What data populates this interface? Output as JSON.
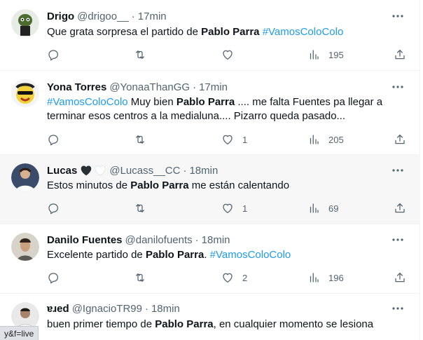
{
  "tweets": [
    {
      "name": "Drigo",
      "handle": "@drigoo__",
      "time": "17min",
      "pre": "Que grata sorpresa el partido de ",
      "bold": "Pablo Parra",
      "post": " ",
      "tag": "#VamosColoColo",
      "post2": "",
      "line2": "",
      "likes": "",
      "views": "195"
    },
    {
      "name": "Yona Torres",
      "handle": "@YonaaThanGG",
      "time": "17min",
      "tag": "#VamosColoColo",
      "pre": " Muy bien ",
      "bold": "Pablo Parra",
      "post": " .... me falta Fuentes pa llegar a",
      "line2": "terminar esos centros a la medialuna.... Pizarro queda pasado...",
      "likes": "1",
      "views": "205"
    },
    {
      "name": "Lucas",
      "handle": "@Lucass__CC",
      "time": "18min",
      "pre": "Estos minutos de ",
      "bold": "Pablo Parra",
      "post": " me están calentando",
      "likes": "1",
      "views": "69",
      "hearts": [
        "black-heart-icon",
        "white-heart-icon"
      ]
    },
    {
      "name": "Danilo Fuentes",
      "handle": "@danilofuents",
      "time": "18min",
      "pre": "Excelente partido de ",
      "bold": "Pablo Parra",
      "post": ". ",
      "tag": "#VamosColoColo",
      "likes": "2",
      "views": "196"
    },
    {
      "name": "ɐɹed",
      "handle": "@IgnacioTR99",
      "time": "18min",
      "pre": "buen primer tiempo de ",
      "bold": "Pablo Parra",
      "post": ", en cualquier momento se lesiona"
    }
  ],
  "separator": "·",
  "status_url": "y&f=live",
  "icons": {
    "reply": "reply-icon",
    "retweet": "retweet-icon",
    "like": "heart-icon",
    "views": "views-icon",
    "share": "share-icon",
    "more": "more-icon"
  },
  "colors": {
    "accent": "#1d9bf0",
    "muted": "#536471",
    "text": "#0f1419",
    "highlight_bg": "#f7f7f7"
  }
}
